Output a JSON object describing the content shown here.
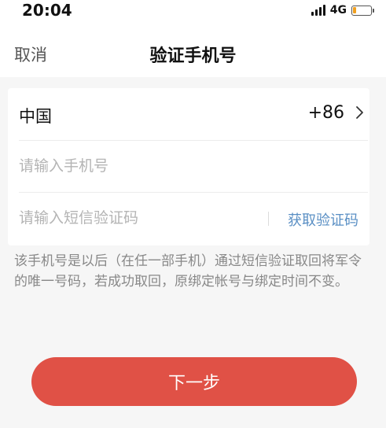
{
  "status_bar": {
    "time": "20:04",
    "network": "4G"
  },
  "nav": {
    "cancel_label": "取消",
    "title": "验证手机号"
  },
  "form": {
    "country_name": "中国",
    "country_code": "+86",
    "phone_placeholder": "请输入手机号",
    "code_placeholder": "请输入短信验证码",
    "get_code_label": "获取验证码"
  },
  "notice_text": "该手机号是以后（在任一部手机）通过短信验证取回将军令的唯一号码，若成功取回，原绑定帐号与绑定时间不变。",
  "next_button_label": "下一步",
  "colors": {
    "accent_button": "#e05146",
    "link": "#5a8fc4",
    "battery_low": "#f0a020"
  }
}
